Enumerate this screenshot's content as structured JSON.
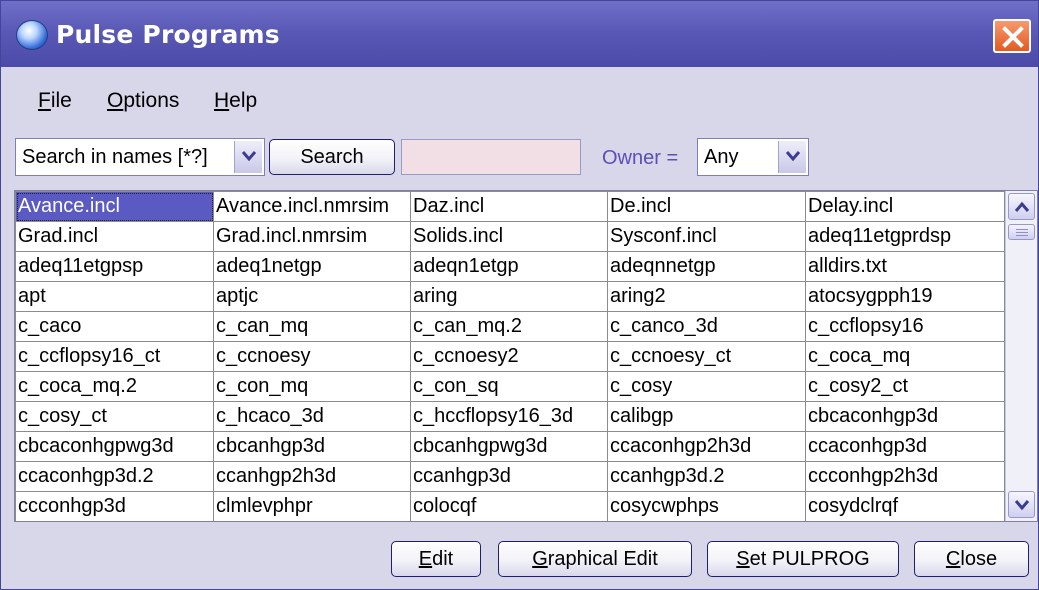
{
  "window": {
    "title": "Pulse Programs"
  },
  "menu": [
    {
      "label": "File"
    },
    {
      "label": "Options"
    },
    {
      "label": "Help"
    }
  ],
  "toolbar": {
    "search_scope": "Search in names [*?]",
    "search_button": "Search",
    "search_value": "",
    "owner_label": "Owner =",
    "owner_value": "Any"
  },
  "table": {
    "selected": "Avance.incl",
    "rows": [
      [
        "Avance.incl",
        "Avance.incl.nmrsim",
        "Daz.incl",
        "De.incl",
        "Delay.incl"
      ],
      [
        "Grad.incl",
        "Grad.incl.nmrsim",
        "Solids.incl",
        "Sysconf.incl",
        "adeq11etgprdsp"
      ],
      [
        "adeq11etgpsp",
        "adeq1netgp",
        "adeqn1etgp",
        "adeqnnetgp",
        "alldirs.txt"
      ],
      [
        "apt",
        "aptjc",
        "aring",
        "aring2",
        "atocsygpph19"
      ],
      [
        "c_caco",
        "c_can_mq",
        "c_can_mq.2",
        "c_canco_3d",
        "c_ccflopsy16"
      ],
      [
        "c_ccflopsy16_ct",
        "c_ccnoesy",
        "c_ccnoesy2",
        "c_ccnoesy_ct",
        "c_coca_mq"
      ],
      [
        "c_coca_mq.2",
        "c_con_mq",
        "c_con_sq",
        "c_cosy",
        "c_cosy2_ct"
      ],
      [
        "c_cosy_ct",
        "c_hcaco_3d",
        "c_hccflopsy16_3d",
        "calibgp",
        "cbcaconhgp3d"
      ],
      [
        "cbcaconhgpwg3d",
        "cbcanhgp3d",
        "cbcanhgpwg3d",
        "ccaconhgp2h3d",
        "ccaconhgp3d"
      ],
      [
        "ccaconhgp3d.2",
        "ccanhgp2h3d",
        "ccanhgp3d",
        "ccanhgp3d.2",
        "ccconhgp2h3d"
      ],
      [
        "ccconhgp3d",
        "clmlevphpr",
        "colocqf",
        "cosycwphps",
        "cosydclrqf"
      ]
    ]
  },
  "buttons": {
    "edit": "Edit",
    "graphical_edit": "Graphical Edit",
    "set_pulprog": "Set PULPROG",
    "close": "Close"
  },
  "icons": {
    "app": "pulse-app-icon",
    "close": "close-icon",
    "dropdown": "chevron-down-icon",
    "scroll_up": "arrow-up-icon",
    "scroll_down": "arrow-down-icon"
  },
  "colors": {
    "titlebar": "#5a59b6",
    "selection": "#5b59c2",
    "close_button": "#e45a22",
    "search_field": "#f2dfe6"
  }
}
